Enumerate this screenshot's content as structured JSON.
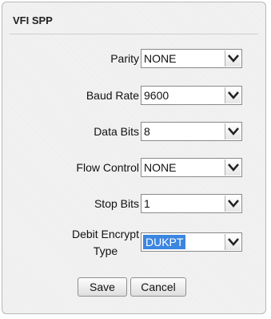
{
  "panel": {
    "title": "VFI SPP"
  },
  "fields": {
    "parity": {
      "label": "Parity",
      "value": "NONE"
    },
    "baud_rate": {
      "label": "Baud Rate",
      "value": "9600"
    },
    "data_bits": {
      "label": "Data Bits",
      "value": "8"
    },
    "flow_control": {
      "label": "Flow Control",
      "value": "NONE"
    },
    "stop_bits": {
      "label": "Stop Bits",
      "value": "1"
    },
    "debit_encrypt_type": {
      "label_line1": "Debit Encrypt",
      "label_line2": "Type",
      "value": "DUKPT"
    }
  },
  "buttons": {
    "save_label": "Save",
    "cancel_label": "Cancel"
  },
  "icons": {
    "dropdown": "chevron-down-icon"
  },
  "colors": {
    "selection_highlight": "#3b86e0"
  }
}
